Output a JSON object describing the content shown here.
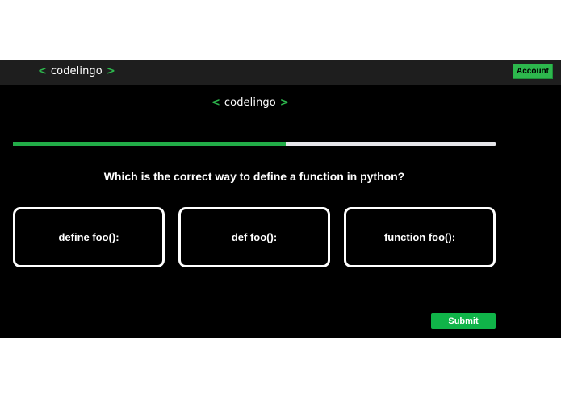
{
  "brand": {
    "left_bracket": "<",
    "name": "codelingo",
    "right_bracket": ">"
  },
  "header": {
    "account_label": "Account"
  },
  "quiz": {
    "progress_fraction": 0.565,
    "question": "Which is the correct way to define a function in python?",
    "options": [
      {
        "label": "define foo():"
      },
      {
        "label": "def foo():"
      },
      {
        "label": "function foo():"
      }
    ],
    "submit_label": "Submit"
  },
  "colors": {
    "accent": "#2db84d",
    "progress_fill": "#22ad48",
    "progress_track": "#e6e6ea",
    "submit": "#10b449",
    "background": "#000000",
    "topbar": "#1e1e1e"
  }
}
